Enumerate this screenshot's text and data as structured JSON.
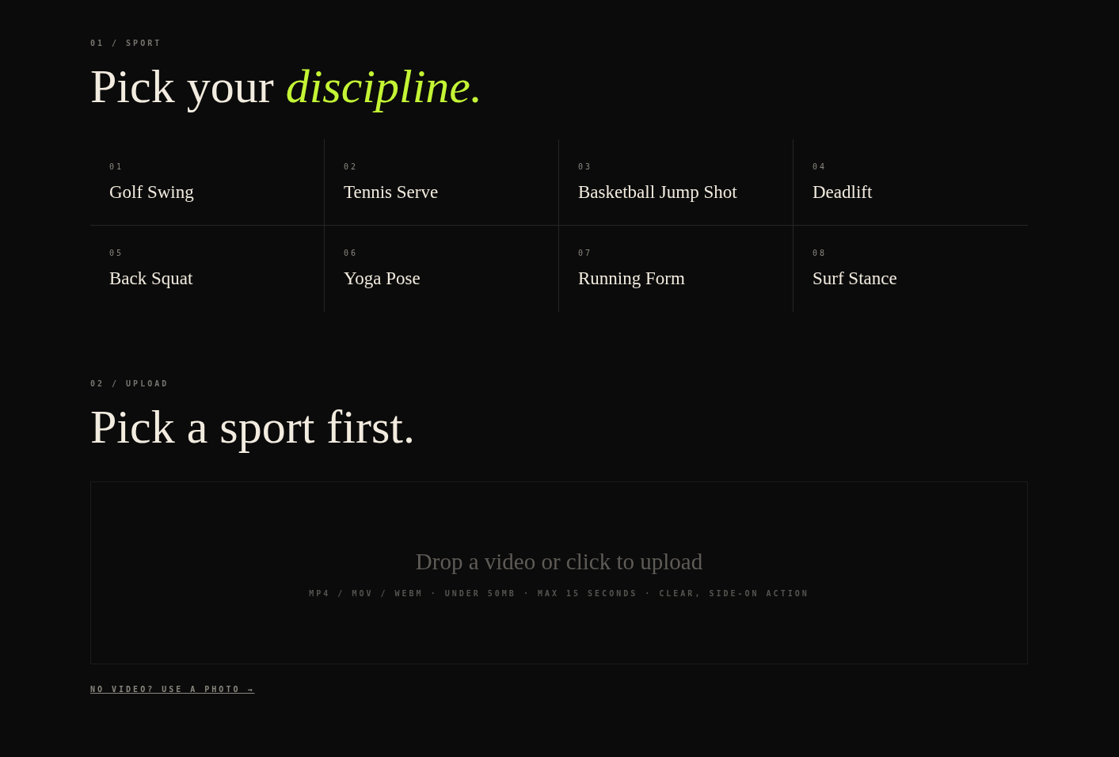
{
  "sport_section": {
    "eyebrow": "01 / SPORT",
    "heading": "Pick your *discipline.*",
    "sports": [
      {
        "number": "01",
        "name": "Golf Swing"
      },
      {
        "number": "02",
        "name": "Tennis Serve"
      },
      {
        "number": "03",
        "name": "Basketball Jump Shot"
      },
      {
        "number": "04",
        "name": "Deadlift"
      },
      {
        "number": "05",
        "name": "Back Squat"
      },
      {
        "number": "06",
        "name": "Yoga Pose"
      },
      {
        "number": "07",
        "name": "Running Form"
      },
      {
        "number": "08",
        "name": "Surf Stance"
      }
    ]
  },
  "upload_section": {
    "eyebrow": "02 / UPLOAD",
    "heading": "Pick a sport first.",
    "dropzone": {
      "title": "Drop a video or click to upload",
      "hint": "MP4 / MOV / WEBM · UNDER 50MB · MAX 15 SECONDS · CLEAR, SIDE-ON ACTION"
    },
    "photo_link": "NO VIDEO? USE A PHOTO →"
  }
}
